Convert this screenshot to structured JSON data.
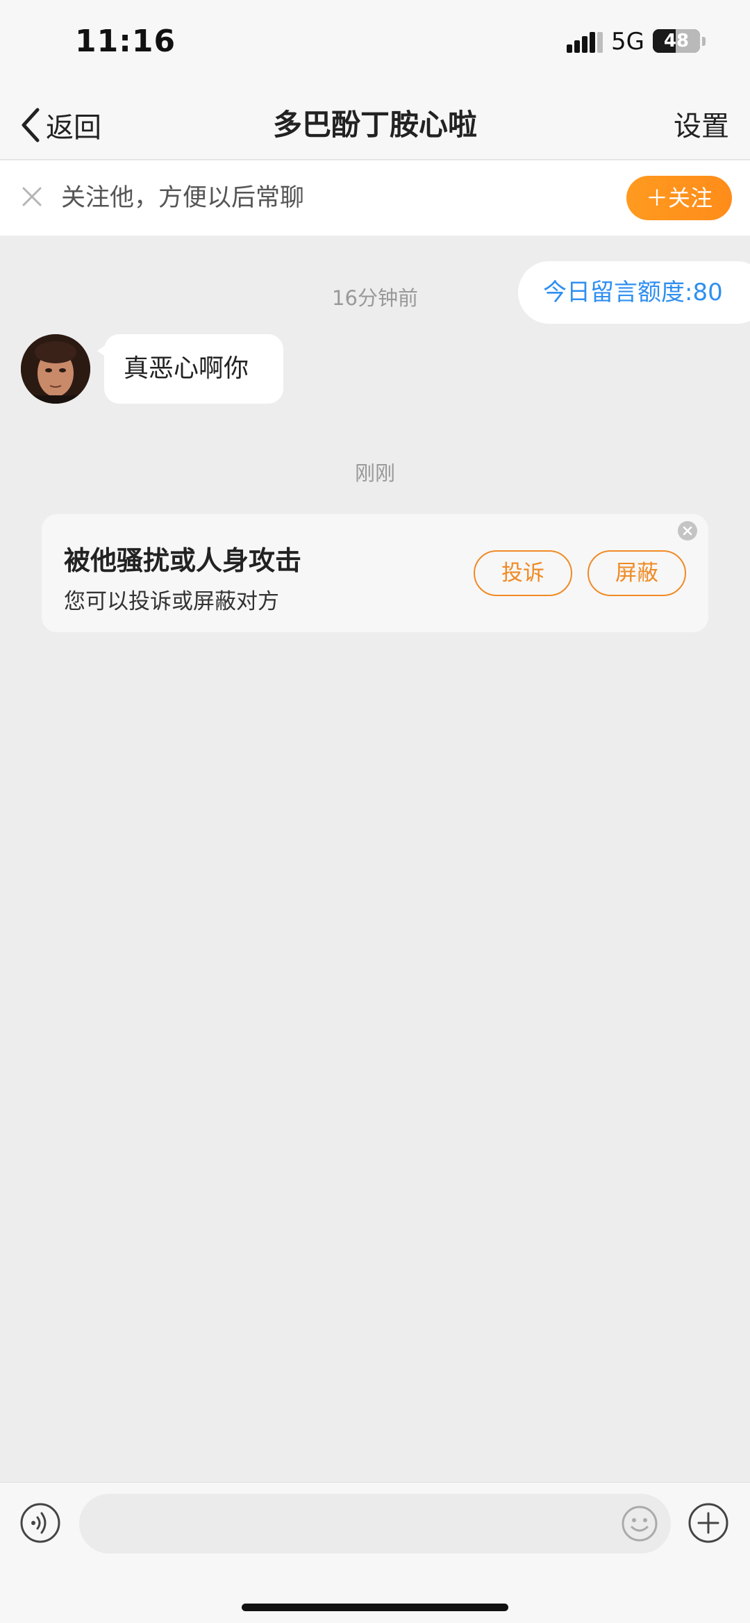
{
  "status_bar": {
    "time": "11:16",
    "network": "5G",
    "battery_label": "48",
    "battery_level": 0.48,
    "signal_icon": "signal-bars-icon"
  },
  "nav": {
    "back_label": "返回",
    "back_icon": "chevron-left-icon",
    "title": "多巴酚丁胺心啦",
    "settings_label": "设置"
  },
  "follow_banner": {
    "close_icon": "close-icon",
    "text": "关注他，方便以后常聊",
    "button_label": "＋关注",
    "button_color": "#ff8c1a"
  },
  "chat": {
    "quota_label": "今日留言额度:80",
    "quota_color": "#2f8ff0",
    "timestamp_1": "16分钟前",
    "message_1": "真恶心啊你",
    "timestamp_2": "刚刚"
  },
  "report_card": {
    "title": "被他骚扰或人身攻击",
    "subtitle": "您可以投诉或屏蔽对方",
    "complain_label": "投诉",
    "block_label": "屏蔽",
    "accent_color": "#f08a24",
    "close_icon": "close-circle-icon"
  },
  "input_bar": {
    "placeholder": "",
    "voice_icon": "voice-icon",
    "emoji_icon": "emoji-icon",
    "add_icon": "plus-circle-icon"
  }
}
